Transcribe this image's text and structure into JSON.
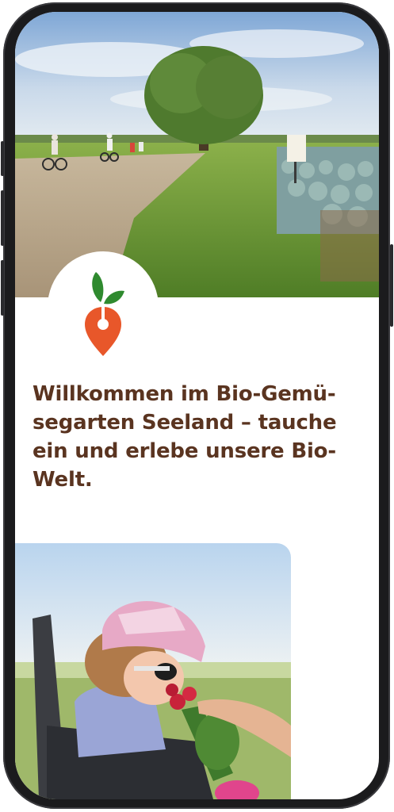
{
  "headline": {
    "text": "Willkommen im Bio-Gemü­segarten Seeland – tauche ein und erlebe unsere Bio-Welt."
  },
  "logo": {
    "icon": "carrot-pin-logo",
    "colors": {
      "leaf": "#2f8a2f",
      "pin": "#e8572a"
    }
  },
  "colors": {
    "headline": "#5a3420",
    "background": "#ffffff",
    "frame": "#1b1b1d"
  }
}
